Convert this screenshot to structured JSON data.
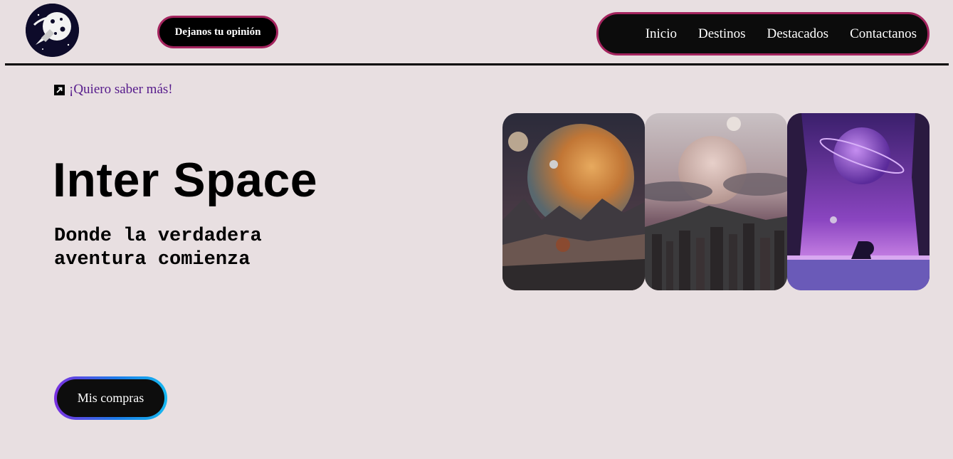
{
  "header": {
    "logo_icon": "astronaut-planet-logo-icon",
    "feedback_label": "Dejanos tu opinión",
    "nav": [
      {
        "label": "Inicio"
      },
      {
        "label": "Destinos"
      },
      {
        "label": "Destacados"
      },
      {
        "label": "Contactanos"
      }
    ]
  },
  "hero": {
    "link_icon": "external-link-icon",
    "link_label": "¡Quiero saber más!",
    "title": "Inter Space",
    "subtitle": "Donde la verdadera aventura comienza",
    "purchases_label": "Mis compras"
  },
  "gallery": [
    {
      "name": "desert-planet-image"
    },
    {
      "name": "city-planet-image"
    },
    {
      "name": "purple-planet-image"
    }
  ],
  "colors": {
    "background": "#e8dfe1",
    "accent_border": "#a4245e",
    "link": "#551a8b",
    "button_bg": "#0c0c0c"
  }
}
